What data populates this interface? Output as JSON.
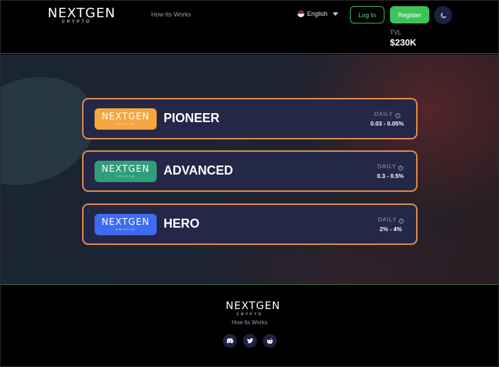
{
  "header": {
    "logo_text": "NEXTGEN",
    "logo_sub": "CRYPTO",
    "nav_link": "How Its Works",
    "language": "English",
    "login_label": "Log In",
    "register_label": "Register",
    "tvl_label": "TVL",
    "tvl_value": "$230K"
  },
  "tiers": [
    {
      "name": "PIONEER",
      "badge_text": "NEXTGEN",
      "badge_sub": "CRYPTO",
      "daily_label": "DAILY",
      "daily_value": "0.03 - 0.05%",
      "badge_color": "#f5a640"
    },
    {
      "name": "ADVANCED",
      "badge_text": "NEXTGEN",
      "badge_sub": "CRYPTO",
      "daily_label": "DAILY",
      "daily_value": "0.3 - 0.5%",
      "badge_color": "#2f9e78"
    },
    {
      "name": "HERO",
      "badge_text": "NEXTGEN",
      "badge_sub": "CRYPTO",
      "daily_label": "DAILY",
      "daily_value": "2% - 4%",
      "badge_color": "#3d6cf2"
    }
  ],
  "footer": {
    "logo_text": "NEXTGEN",
    "logo_sub": "CRYPTO",
    "link": "How Its Works",
    "socials": [
      "discord-icon",
      "twitter-icon",
      "reddit-icon"
    ]
  },
  "colors": {
    "accent_green": "#3cc35a",
    "tier_border": "#e8934a",
    "tier_bg": "#252748"
  }
}
